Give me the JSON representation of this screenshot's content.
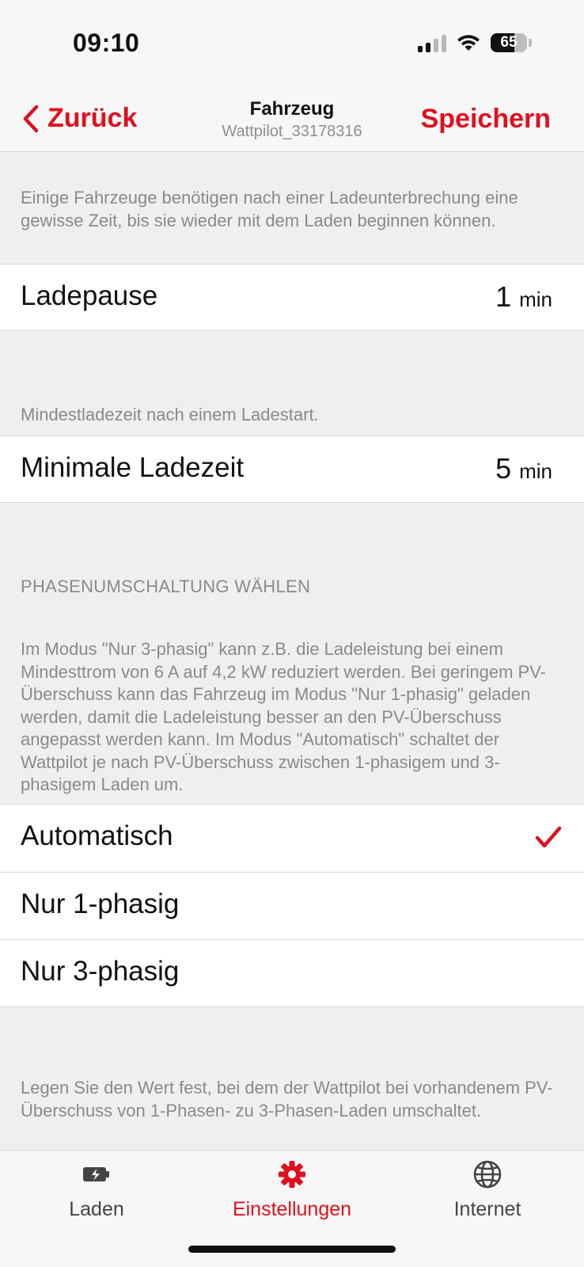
{
  "status": {
    "time": "09:10",
    "battery": "65",
    "battery_fraction": 0.65
  },
  "nav": {
    "back_label": "Zurück",
    "title": "Fahrzeug",
    "subtitle": "Wattpilot_33178316",
    "save_label": "Speichern"
  },
  "sections": {
    "pause_note": "Einige Fahrzeuge benötigen nach einer Ladeunterbrechung eine gewisse Zeit, bis sie wieder mit dem Laden beginnen können.",
    "pause": {
      "label": "Ladepause",
      "value": "1",
      "unit": "min"
    },
    "min_note": "Mindestladezeit nach einem Ladestart.",
    "min": {
      "label": "Minimale Ladezeit",
      "value": "5",
      "unit": "min"
    },
    "phase_caption": "PHASENUMSCHALTUNG WÄHLEN",
    "phase_note": "Im Modus \"Nur 3-phasig\" kann z.B. die Ladeleistung bei einem Mindesttrom von 6 A auf 4,2 kW reduziert werden. Bei geringem PV-Überschuss kann das Fahrzeug im Modus \"Nur 1-phasig\" geladen werden, damit die Ladeleistung besser an den PV-Überschuss angepasst werden kann. Im Modus \"Automatisch\" schaltet der Wattpilot je nach PV-Überschuss zwischen 1-phasigem und 3-phasigem Laden um.",
    "phase_options": [
      "Automatisch",
      "Nur 1-phasig",
      "Nur 3-phasig"
    ],
    "phase_selected": "Automatisch",
    "threshold_note": "Legen Sie den Wert fest, bei dem der Wattpilot bei vorhandenem PV-Überschuss von 1-Phasen- zu 3-Phasen-Laden umschaltet."
  },
  "tabs": [
    {
      "label": "Laden",
      "icon": "battery-charging-icon"
    },
    {
      "label": "Einstellungen",
      "icon": "gear-icon",
      "active": true
    },
    {
      "label": "Internet",
      "icon": "globe-icon"
    }
  ],
  "colors": {
    "accent": "#e0101f",
    "background": "#efeff0",
    "secondary_text": "#8a8a8e"
  }
}
